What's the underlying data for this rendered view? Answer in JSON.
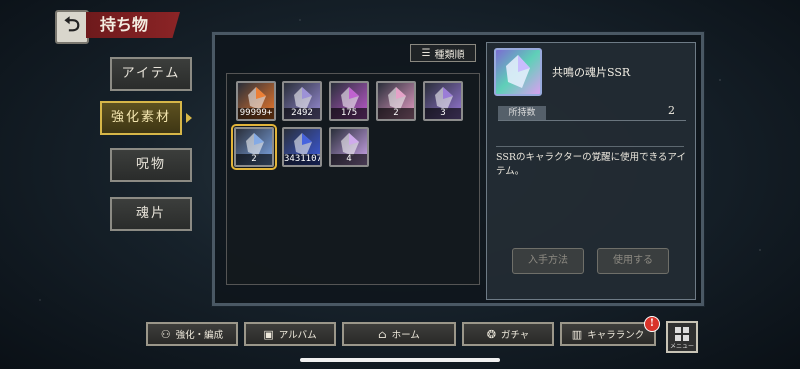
{
  "header": {
    "title": "持ち物",
    "back_icon": "back-arrow-icon"
  },
  "categories": [
    {
      "label": "アイテム",
      "active": false
    },
    {
      "label": "強化素材",
      "active": true
    },
    {
      "label": "呪物",
      "active": false
    },
    {
      "label": "魂片",
      "active": false
    }
  ],
  "sort": {
    "label": "種類順",
    "icon": "sort-icon"
  },
  "items": [
    {
      "count": "99999+",
      "color": "#f07a2a",
      "icon": "fire-orb-icon"
    },
    {
      "count": "2492",
      "color": "#9a8ed8",
      "icon": "crystal-cluster-icon"
    },
    {
      "count": "175",
      "color": "#c05ad0",
      "icon": "magenta-crystal-icon"
    },
    {
      "count": "2",
      "color": "#e8a0c8",
      "icon": "rainbow-crystal-icon"
    },
    {
      "count": "3",
      "color": "#9878d8",
      "icon": "soul-shard-icon"
    },
    {
      "count": "2",
      "color": "#7fa8e8",
      "icon": "soul-shard-ssr-icon"
    },
    {
      "count": "3431107",
      "color": "#3c5be0",
      "icon": "blue-orb-icon"
    },
    {
      "count": "4",
      "color": "#d0a8f0",
      "icon": "card-icon"
    }
  ],
  "detail": {
    "name": "共鳴の魂片SSR",
    "qty_label": "所持数",
    "qty_value": "2",
    "description": "SSRのキャラクターの覚醒に使用できるアイテム。",
    "obtain_button": "入手方法",
    "use_button": "使用する"
  },
  "bottom_nav": [
    {
      "label": "強化・編成",
      "icon": "team-icon"
    },
    {
      "label": "アルバム",
      "icon": "album-icon"
    },
    {
      "label": "ホーム",
      "icon": "home-icon"
    },
    {
      "label": "ガチャ",
      "icon": "gacha-icon"
    },
    {
      "label": "キャラランク",
      "icon": "rank-icon"
    }
  ],
  "menu": {
    "label": "メニュー",
    "badge": "!"
  }
}
